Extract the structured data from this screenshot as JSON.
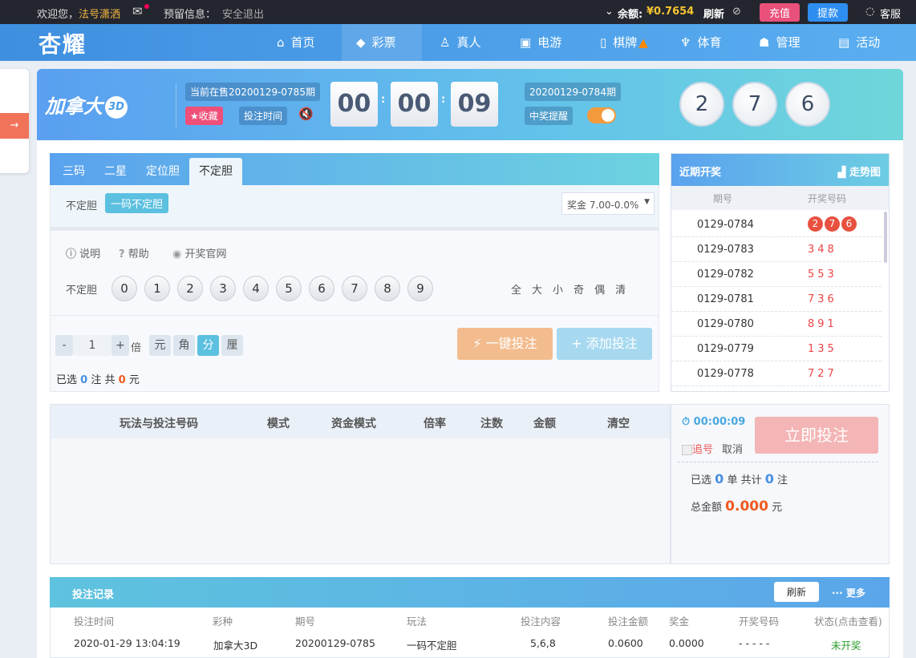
{
  "topbar": {
    "welcome": "欢迎您，",
    "username": "法号潇洒",
    "notice_label": "预留信息：",
    "logout": "安全退出",
    "balance_label": "余额:",
    "balance": "¥0.7654",
    "refresh": "刷新",
    "recharge": "充值",
    "withdraw": "提款",
    "service": "客服"
  },
  "nav": {
    "logo": "杏耀",
    "items": [
      {
        "icon": "⌂",
        "label": "首页"
      },
      {
        "icon": "◆",
        "label": "彩票"
      },
      {
        "icon": "♙",
        "label": "真人"
      },
      {
        "icon": "▣",
        "label": "电游"
      },
      {
        "icon": "▯",
        "label": "棋牌"
      },
      {
        "icon": "♆",
        "label": "体育"
      },
      {
        "icon": "☗",
        "label": "管理"
      },
      {
        "icon": "▤",
        "label": "活动"
      }
    ]
  },
  "game": {
    "name": "加拿大",
    "badge": "3D",
    "current_issue": "当前在售20200129-0785期",
    "favorite": "★收藏",
    "bet_time": "投注时间",
    "countdown": [
      "00",
      "00",
      "09"
    ],
    "last_issue": "20200129-0784期",
    "win_alert": "中奖提醒",
    "last_result": [
      "2",
      "7",
      "6"
    ]
  },
  "play": {
    "tabs": [
      "三码",
      "二星",
      "定位胆",
      "不定胆"
    ],
    "active_tab": 3,
    "subgroup_label": "不定胆",
    "subtype": "一码不定胆",
    "prize_select": "奖金 7.00-0.0%",
    "links": [
      "说明",
      "帮助",
      "开奖官网"
    ],
    "row_label": "不定胆",
    "numbers": [
      "0",
      "1",
      "2",
      "3",
      "4",
      "5",
      "6",
      "7",
      "8",
      "9"
    ],
    "quick": [
      "全",
      "大",
      "小",
      "奇",
      "偶",
      "清"
    ],
    "multiplier": "1",
    "minus": "-",
    "plus": "+",
    "times_label": "倍",
    "units": [
      "元",
      "角",
      "分",
      "厘"
    ],
    "active_unit": 2,
    "selected_prefix": "已选",
    "selected_count": "0",
    "selected_mid": "注  共",
    "selected_amount": "0",
    "selected_suffix": "元",
    "one_click": "一键投注",
    "add_bet": "添加投注"
  },
  "recent": {
    "title": "近期开奖",
    "trend": "走势图",
    "col_issue": "期号",
    "col_numbers": "开奖号码",
    "rows": [
      {
        "issue": "0129-0784",
        "numbers": "276"
      },
      {
        "issue": "0129-0783",
        "numbers": "348"
      },
      {
        "issue": "0129-0782",
        "numbers": "553"
      },
      {
        "issue": "0129-0781",
        "numbers": "736"
      },
      {
        "issue": "0129-0780",
        "numbers": "891"
      },
      {
        "issue": "0129-0779",
        "numbers": "135"
      },
      {
        "issue": "0129-0778",
        "numbers": "727"
      }
    ]
  },
  "betlist": {
    "headers": [
      "玩法与投注号码",
      "模式",
      "资金模式",
      "倍率",
      "注数",
      "金额",
      "清空"
    ]
  },
  "submit": {
    "timer": "00:00:09",
    "chase": "追号",
    "cancel": "取消",
    "submit_btn": "立即投注",
    "sel_prefix": "已选",
    "sel_orders": "0",
    "sel_mid": "单 共计",
    "sel_bets": "0",
    "sel_suffix": "注",
    "total_label": "总金额",
    "total": "0.000",
    "total_unit": "元"
  },
  "records": {
    "title": "投注记录",
    "refresh": "刷新",
    "more": "··· 更多",
    "headers": [
      "投注时间",
      "彩种",
      "期号",
      "玩法",
      "投注内容",
      "投注金额",
      "奖金",
      "开奖号码",
      "状态(点击查看)"
    ],
    "rows": [
      [
        "2020-01-29 13:04:19",
        "加拿大3D",
        "20200129-0785",
        "一码不定胆",
        "5,6,8",
        "0.0600",
        "0.0000",
        "- - - - -",
        "未开奖"
      ]
    ]
  }
}
